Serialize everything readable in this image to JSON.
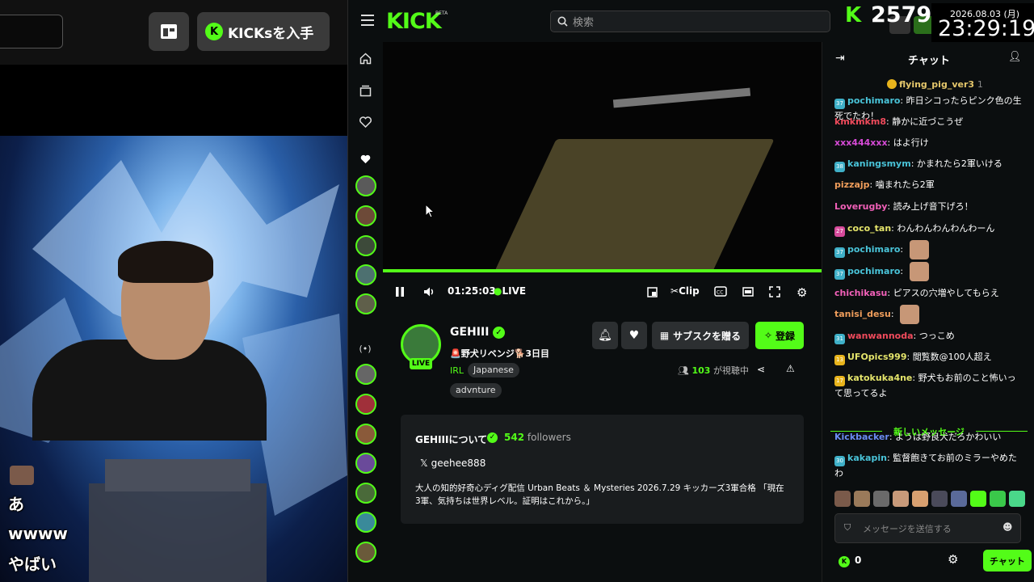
{
  "left_overlay": {
    "kicks_button": "KICKsを入手",
    "chat_lines": [
      "あ",
      "wwww",
      "やばい"
    ]
  },
  "header": {
    "logo": "KICK",
    "beta": "BETA",
    "search_placeholder": "検索"
  },
  "overlay": {
    "counter": "2579",
    "date": "2026.08.03 (月)",
    "time": "23:29:19"
  },
  "player": {
    "elapsed": "01:25:03",
    "live_label": "LIVE",
    "clip_label": "Clip"
  },
  "channel": {
    "name": "GEHIII",
    "live_badge": "LIVE",
    "stream_title": "🚨野犬リベンジ🐕3日目",
    "category": "IRL",
    "tags": [
      "Japanese",
      "advnture"
    ],
    "subscribe_label": "サブスクを贈る",
    "register_label": "登録",
    "viewer_count": "103",
    "viewer_suffix": "が視聴中"
  },
  "about": {
    "title": "GEHIIIについて",
    "followers": "542",
    "followers_label": "followers",
    "social": "geehee888",
    "description": "大人の知的好奇心ディグ配信 Urban Beats ＆ Mysteries 2026.7.29 キッカーズ3軍合格 「現在3軍、気持ちは世界レベル。証明はこれから。」"
  },
  "chat": {
    "title": "チャット",
    "pinned_user": "flying_pig_ver3",
    "pinned_count": "1",
    "messages": [
      {
        "badge": "37",
        "badge_color": "#3fb0c8",
        "user": "pochimaro",
        "color": "#49c3d8",
        "text": "昨日シコったらピンク色の生死でたわ！"
      },
      {
        "badge": "",
        "badge_color": "",
        "user": "kmkmkm8",
        "color": "#f04b5c",
        "text": "静かに近づこうぜ"
      },
      {
        "badge": "",
        "badge_color": "",
        "user": "xxx444xxx",
        "color": "#d54ad5",
        "text": "はよ行け"
      },
      {
        "badge": "38",
        "badge_color": "#3fb0c8",
        "user": "kaningsmym",
        "color": "#49c3d8",
        "text": "かまれたら2軍いける"
      },
      {
        "badge": "",
        "badge_color": "",
        "user": "pizzajp",
        "color": "#ef9d5b",
        "text": "噛まれたら2軍"
      },
      {
        "badge": "",
        "badge_color": "",
        "user": "Loverugby",
        "color": "#f160b8",
        "text": "読み上げ音下げろ！"
      },
      {
        "badge": "27",
        "badge_color": "#d64a9a",
        "user": "coco_tan",
        "color": "#e5e56b",
        "text": "わんわんわんわんわーん"
      },
      {
        "badge": "37",
        "badge_color": "#3fb0c8",
        "user": "pochimaro",
        "color": "#49c3d8",
        "text": ""
      },
      {
        "badge": "37",
        "badge_color": "#3fb0c8",
        "user": "pochimaro",
        "color": "#49c3d8",
        "text": ""
      },
      {
        "badge": "",
        "badge_color": "",
        "user": "chichikasu",
        "color": "#f160b8",
        "text": "ピアスの穴増やしてもらえ"
      },
      {
        "badge": "",
        "badge_color": "",
        "user": "tanisi_desu",
        "color": "#ef9d5b",
        "text": ""
      },
      {
        "badge": "31",
        "badge_color": "#3fb0c8",
        "user": "wanwannoda",
        "color": "#f04b5c",
        "text": "つっこめ"
      },
      {
        "badge": "13",
        "badge_color": "#e8b41c",
        "user": "UFOpics999",
        "color": "#e5e56b",
        "text": "閲覧数@100人超え"
      },
      {
        "badge": "17",
        "badge_color": "#e8b41c",
        "user": "katokuka4ne",
        "color": "#e5e56b",
        "text": "野犬もお前のこと怖いって思ってるよ"
      },
      {
        "badge": "",
        "badge_color": "",
        "user": "Kickbacker",
        "color": "#6b8cf2",
        "text": "ようは野良犬だろかわいい"
      },
      {
        "badge": "30",
        "badge_color": "#3fb0c8",
        "user": "kakapin",
        "color": "#49c3d8",
        "text": "監督飽きてお前のミラーやめたわ"
      }
    ],
    "new_messages_label": "新しいメッセージ",
    "input_placeholder": "メッセージを送信する",
    "kicks_balance": "0",
    "send_label": "チャット"
  },
  "colors": {
    "accent": "#53fc18",
    "bg": "#0b0e0f",
    "panel": "#191c1e"
  }
}
